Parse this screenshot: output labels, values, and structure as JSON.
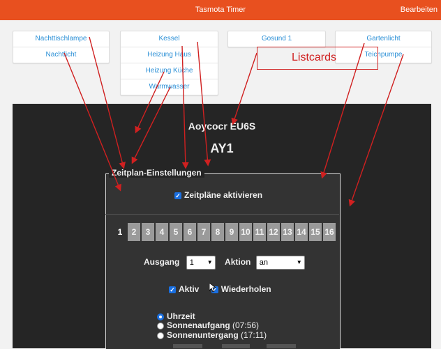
{
  "header": {
    "title": "Tasmota Timer",
    "edit_label": "Bearbeiten",
    "bg_color": "#e8501f"
  },
  "cards": [
    {
      "items": [
        "Nachttischlampe",
        "Nachtlicht"
      ]
    },
    {
      "items": [
        "Kessel",
        "Heizung Haus",
        "Heizung Küche",
        "Warmwasser"
      ]
    },
    {
      "items": [
        "Gosund 1"
      ]
    },
    {
      "items": [
        "Gartenlicht",
        "Teichpumpe"
      ]
    }
  ],
  "annotation": {
    "label": "Listcards",
    "color": "#d02020"
  },
  "device": {
    "name": "Aoycocr EU6S",
    "subtitle": "AY1"
  },
  "schedule": {
    "legend": "Zeitplan-Einstellungen",
    "enable_label": "Zeitpläne aktivieren",
    "tabs": [
      "1",
      "2",
      "3",
      "4",
      "5",
      "6",
      "7",
      "8",
      "9",
      "10",
      "11",
      "12",
      "13",
      "14",
      "15",
      "16"
    ],
    "active_tab": "1",
    "output_label": "Ausgang",
    "output_value": "1",
    "action_label": "Aktion",
    "action_value": "an",
    "active_label": "Aktiv",
    "repeat_label": "Wiederholen",
    "mode_time": "Uhrzeit",
    "mode_sunrise": "Sonnenaufgang",
    "sunrise_time": "(07:56)",
    "mode_sunset": "Sonnenuntergang",
    "sunset_time": "(17:11)"
  }
}
